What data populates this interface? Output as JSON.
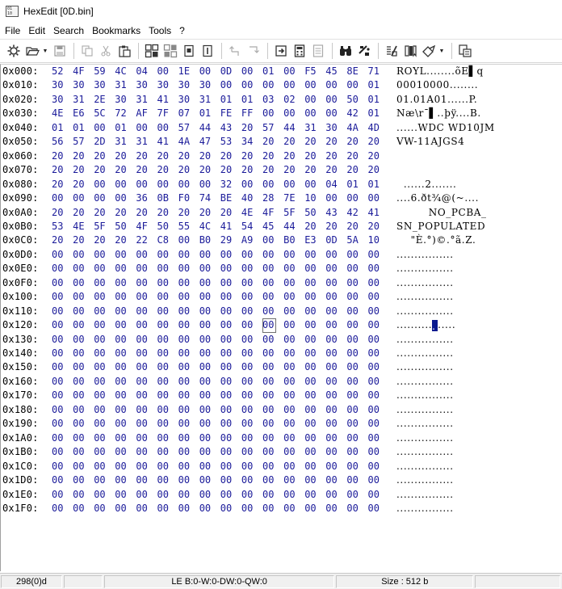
{
  "window": {
    "title": "HexEdit [0D.bin]"
  },
  "menu": [
    "File",
    "Edit",
    "Search",
    "Bookmarks",
    "Tools",
    "?"
  ],
  "toolbar": {
    "icons": [
      "settings-icon",
      "open-folder-icon",
      "save-icon",
      "copy-icon",
      "cut-icon",
      "paste-icon",
      "tile-icon",
      "tile-alt-icon",
      "page-icon",
      "page-alt-icon",
      "undo-icon",
      "redo-icon",
      "goto-icon",
      "calc-icon",
      "grid-icon",
      "find-icon",
      "replace-icon",
      "compare-icon",
      "bookmark-icon",
      "export-icon",
      "properties-icon"
    ]
  },
  "hex": {
    "rows": [
      {
        "addr": "0x000:",
        "bytes": [
          "52",
          "4F",
          "59",
          "4C",
          "04",
          "00",
          "1E",
          "00",
          "0D",
          "00",
          "01",
          "00",
          "F5",
          "45",
          "8E",
          "71"
        ],
        "ascii": "ROYL........õE▌q"
      },
      {
        "addr": "0x010:",
        "bytes": [
          "30",
          "30",
          "30",
          "31",
          "30",
          "30",
          "30",
          "30",
          "00",
          "00",
          "00",
          "00",
          "00",
          "00",
          "00",
          "01"
        ],
        "ascii": "00010000........"
      },
      {
        "addr": "0x020:",
        "bytes": [
          "30",
          "31",
          "2E",
          "30",
          "31",
          "41",
          "30",
          "31",
          "01",
          "01",
          "03",
          "02",
          "00",
          "00",
          "50",
          "01"
        ],
        "ascii": "01.01A01......P."
      },
      {
        "addr": "0x030:",
        "bytes": [
          "4E",
          "E6",
          "5C",
          "72",
          "AF",
          "7F",
          "07",
          "01",
          "FE",
          "FF",
          "00",
          "00",
          "00",
          "00",
          "42",
          "01"
        ],
        "ascii": "Næ\\r¯▌..þÿ....B."
      },
      {
        "addr": "0x040:",
        "bytes": [
          "01",
          "01",
          "00",
          "01",
          "00",
          "00",
          "57",
          "44",
          "43",
          "20",
          "57",
          "44",
          "31",
          "30",
          "4A",
          "4D"
        ],
        "ascii": "......WDC WD10JM"
      },
      {
        "addr": "0x050:",
        "bytes": [
          "56",
          "57",
          "2D",
          "31",
          "31",
          "41",
          "4A",
          "47",
          "53",
          "34",
          "20",
          "20",
          "20",
          "20",
          "20",
          "20"
        ],
        "ascii": "VW-11AJGS4      "
      },
      {
        "addr": "0x060:",
        "bytes": [
          "20",
          "20",
          "20",
          "20",
          "20",
          "20",
          "20",
          "20",
          "20",
          "20",
          "20",
          "20",
          "20",
          "20",
          "20",
          "20"
        ],
        "ascii": "                "
      },
      {
        "addr": "0x070:",
        "bytes": [
          "20",
          "20",
          "20",
          "20",
          "20",
          "20",
          "20",
          "20",
          "20",
          "20",
          "20",
          "20",
          "20",
          "20",
          "20",
          "20"
        ],
        "ascii": "                "
      },
      {
        "addr": "0x080:",
        "bytes": [
          "20",
          "20",
          "00",
          "00",
          "00",
          "00",
          "00",
          "00",
          "32",
          "00",
          "00",
          "00",
          "00",
          "04",
          "01",
          "01"
        ],
        "ascii": "  ......2......."
      },
      {
        "addr": "0x090:",
        "bytes": [
          "00",
          "00",
          "00",
          "00",
          "36",
          "0B",
          "F0",
          "74",
          "BE",
          "40",
          "28",
          "7E",
          "10",
          "00",
          "00",
          "00"
        ],
        "ascii": "....6.ðt¾@(~...."
      },
      {
        "addr": "0x0A0:",
        "bytes": [
          "20",
          "20",
          "20",
          "20",
          "20",
          "20",
          "20",
          "20",
          "20",
          "4E",
          "4F",
          "5F",
          "50",
          "43",
          "42",
          "41",
          "5F"
        ],
        "ascii": "         NO_PCBA_"
      },
      {
        "addr": "0x0B0:",
        "bytes": [
          "53",
          "4E",
          "5F",
          "50",
          "4F",
          "50",
          "55",
          "4C",
          "41",
          "54",
          "45",
          "44",
          "20",
          "20",
          "20",
          "20"
        ],
        "ascii": "SN_POPULATED    "
      },
      {
        "addr": "0x0C0:",
        "bytes": [
          "20",
          "20",
          "20",
          "20",
          "22",
          "C8",
          "00",
          "B0",
          "29",
          "A9",
          "00",
          "B0",
          "E3",
          "0D",
          "5A",
          "10"
        ],
        "ascii": "    \"È.°)©.°ã.Z."
      },
      {
        "addr": "0x0D0:",
        "bytes": [
          "00",
          "00",
          "00",
          "00",
          "00",
          "00",
          "00",
          "00",
          "00",
          "00",
          "00",
          "00",
          "00",
          "00",
          "00",
          "00"
        ],
        "ascii": "................"
      },
      {
        "addr": "0x0E0:",
        "bytes": [
          "00",
          "00",
          "00",
          "00",
          "00",
          "00",
          "00",
          "00",
          "00",
          "00",
          "00",
          "00",
          "00",
          "00",
          "00",
          "00"
        ],
        "ascii": "................"
      },
      {
        "addr": "0x0F0:",
        "bytes": [
          "00",
          "00",
          "00",
          "00",
          "00",
          "00",
          "00",
          "00",
          "00",
          "00",
          "00",
          "00",
          "00",
          "00",
          "00",
          "00"
        ],
        "ascii": "................"
      },
      {
        "addr": "0x100:",
        "bytes": [
          "00",
          "00",
          "00",
          "00",
          "00",
          "00",
          "00",
          "00",
          "00",
          "00",
          "00",
          "00",
          "00",
          "00",
          "00",
          "00"
        ],
        "ascii": "................"
      },
      {
        "addr": "0x110:",
        "bytes": [
          "00",
          "00",
          "00",
          "00",
          "00",
          "00",
          "00",
          "00",
          "00",
          "00",
          "00",
          "00",
          "00",
          "00",
          "00",
          "00"
        ],
        "ascii": "................"
      },
      {
        "addr": "0x120:",
        "bytes": [
          "00",
          "00",
          "00",
          "00",
          "00",
          "00",
          "00",
          "00",
          "00",
          "00",
          "00",
          "00",
          "00",
          "00",
          "00",
          "00"
        ],
        "ascii": "................"
      },
      {
        "addr": "0x130:",
        "bytes": [
          "00",
          "00",
          "00",
          "00",
          "00",
          "00",
          "00",
          "00",
          "00",
          "00",
          "00",
          "00",
          "00",
          "00",
          "00",
          "00"
        ],
        "ascii": "................"
      },
      {
        "addr": "0x140:",
        "bytes": [
          "00",
          "00",
          "00",
          "00",
          "00",
          "00",
          "00",
          "00",
          "00",
          "00",
          "00",
          "00",
          "00",
          "00",
          "00",
          "00"
        ],
        "ascii": "................"
      },
      {
        "addr": "0x150:",
        "bytes": [
          "00",
          "00",
          "00",
          "00",
          "00",
          "00",
          "00",
          "00",
          "00",
          "00",
          "00",
          "00",
          "00",
          "00",
          "00",
          "00"
        ],
        "ascii": "................"
      },
      {
        "addr": "0x160:",
        "bytes": [
          "00",
          "00",
          "00",
          "00",
          "00",
          "00",
          "00",
          "00",
          "00",
          "00",
          "00",
          "00",
          "00",
          "00",
          "00",
          "00"
        ],
        "ascii": "................"
      },
      {
        "addr": "0x170:",
        "bytes": [
          "00",
          "00",
          "00",
          "00",
          "00",
          "00",
          "00",
          "00",
          "00",
          "00",
          "00",
          "00",
          "00",
          "00",
          "00",
          "00"
        ],
        "ascii": "................"
      },
      {
        "addr": "0x180:",
        "bytes": [
          "00",
          "00",
          "00",
          "00",
          "00",
          "00",
          "00",
          "00",
          "00",
          "00",
          "00",
          "00",
          "00",
          "00",
          "00",
          "00"
        ],
        "ascii": "................"
      },
      {
        "addr": "0x190:",
        "bytes": [
          "00",
          "00",
          "00",
          "00",
          "00",
          "00",
          "00",
          "00",
          "00",
          "00",
          "00",
          "00",
          "00",
          "00",
          "00",
          "00"
        ],
        "ascii": "................"
      },
      {
        "addr": "0x1A0:",
        "bytes": [
          "00",
          "00",
          "00",
          "00",
          "00",
          "00",
          "00",
          "00",
          "00",
          "00",
          "00",
          "00",
          "00",
          "00",
          "00",
          "00"
        ],
        "ascii": "................"
      },
      {
        "addr": "0x1B0:",
        "bytes": [
          "00",
          "00",
          "00",
          "00",
          "00",
          "00",
          "00",
          "00",
          "00",
          "00",
          "00",
          "00",
          "00",
          "00",
          "00",
          "00"
        ],
        "ascii": "................"
      },
      {
        "addr": "0x1C0:",
        "bytes": [
          "00",
          "00",
          "00",
          "00",
          "00",
          "00",
          "00",
          "00",
          "00",
          "00",
          "00",
          "00",
          "00",
          "00",
          "00",
          "00"
        ],
        "ascii": "................"
      },
      {
        "addr": "0x1D0:",
        "bytes": [
          "00",
          "00",
          "00",
          "00",
          "00",
          "00",
          "00",
          "00",
          "00",
          "00",
          "00",
          "00",
          "00",
          "00",
          "00",
          "00"
        ],
        "ascii": "................"
      },
      {
        "addr": "0x1E0:",
        "bytes": [
          "00",
          "00",
          "00",
          "00",
          "00",
          "00",
          "00",
          "00",
          "00",
          "00",
          "00",
          "00",
          "00",
          "00",
          "00",
          "00"
        ],
        "ascii": "................"
      },
      {
        "addr": "0x1F0:",
        "bytes": [
          "00",
          "00",
          "00",
          "00",
          "00",
          "00",
          "00",
          "00",
          "00",
          "00",
          "00",
          "00",
          "00",
          "00",
          "00",
          "00"
        ],
        "ascii": "................"
      }
    ],
    "cursor": {
      "row": 18,
      "col": 10
    }
  },
  "status": {
    "offset": "298(0)d",
    "field2": "",
    "endian": "LE B:0-W:0-DW:0-QW:0",
    "size": "Size : 512 b",
    "field5": ""
  }
}
